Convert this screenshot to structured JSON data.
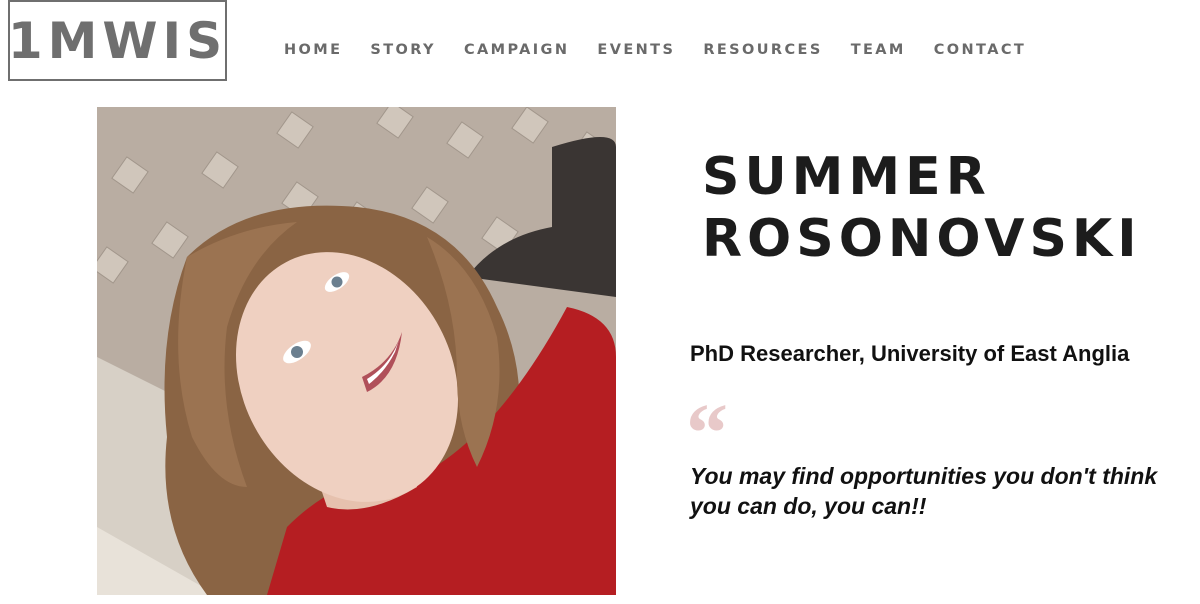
{
  "site": {
    "logo_text": "1MWIS"
  },
  "nav": {
    "items": [
      {
        "label": "HOME"
      },
      {
        "label": "STORY"
      },
      {
        "label": "CAMPAIGN"
      },
      {
        "label": "EVENTS"
      },
      {
        "label": "RESOURCES"
      },
      {
        "label": "TEAM"
      },
      {
        "label": "CONTACT"
      }
    ]
  },
  "profile": {
    "name_line1": "SUMMER",
    "name_line2": "ROSONOVSKI",
    "role": "PhD Researcher, University of East Anglia",
    "quote_mark": "“",
    "quote": "You may find opportunities you don't think you can do, you can!!",
    "photo": {
      "subject": "portrait-photo",
      "colors": {
        "wallpaper": "#b9ada2",
        "hair": "#8a6444",
        "skin": "#efd0c1",
        "sweater": "#b51e22",
        "sofa": "#3a3533"
      }
    }
  },
  "colors": {
    "logo_gray": "#6f6f6f",
    "nav_gray": "#6a6a6a",
    "heading": "#1c1c1c",
    "quote_mark": "#e8c9c9"
  }
}
